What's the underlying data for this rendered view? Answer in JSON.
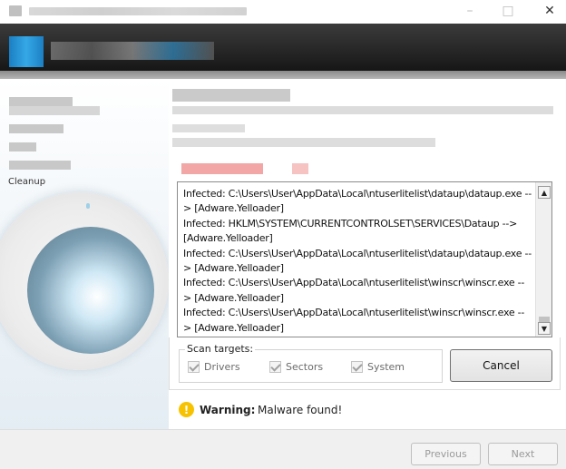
{
  "left_panel": {
    "visible_label": "Cleanup"
  },
  "log": {
    "entries": [
      "Infected: C:\\Users\\User\\AppData\\Local\\ntuserlitelist\\dataup\\dataup.exe --> [Adware.Yelloader]",
      "Infected: HKLM\\SYSTEM\\CURRENTCONTROLSET\\SERVICES\\Dataup --> [Adware.Yelloader]",
      "Infected: C:\\Users\\User\\AppData\\Local\\ntuserlitelist\\dataup\\dataup.exe --> [Adware.Yelloader]",
      "Infected: C:\\Users\\User\\AppData\\Local\\ntuserlitelist\\winscr\\winscr.exe --> [Adware.Yelloader]",
      "Infected: C:\\Users\\User\\AppData\\Local\\ntuserlitelist\\winscr\\winscr.exe --> [Adware.Yelloader]"
    ]
  },
  "scan_targets": {
    "legend": "Scan targets:",
    "drivers": "Drivers",
    "sectors": "Sectors",
    "system": "System"
  },
  "buttons": {
    "cancel": "Cancel",
    "previous": "Previous",
    "next": "Next"
  },
  "warning": {
    "label": "Warning:",
    "message": "Malware found!"
  },
  "colors": {
    "warning": "#f7c300",
    "header": "#222222",
    "accent_blue": "#1a8fd1"
  }
}
